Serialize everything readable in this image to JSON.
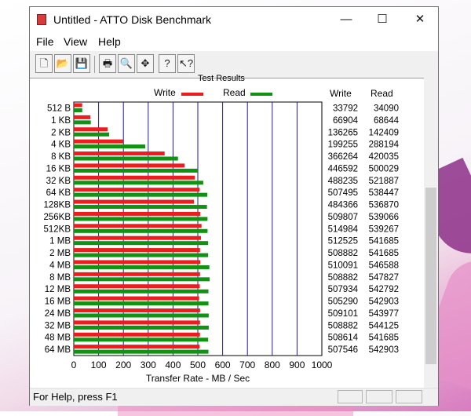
{
  "window": {
    "title": "Untitled - ATTO Disk Benchmark",
    "controls": {
      "minimize": "—",
      "maximize": "☐",
      "close": "✕"
    }
  },
  "menu": {
    "items": [
      "File",
      "View",
      "Help"
    ]
  },
  "toolbar": {
    "buttons": [
      {
        "name": "new-document-icon",
        "glyph": "🗋"
      },
      {
        "name": "open-folder-icon",
        "glyph": "📂"
      },
      {
        "name": "save-icon",
        "glyph": "💾"
      },
      {
        "name": "print-icon",
        "glyph": "🖶"
      },
      {
        "name": "print-preview-icon",
        "glyph": "🔍"
      },
      {
        "name": "move-icon",
        "glyph": "✥"
      },
      {
        "name": "help-icon",
        "glyph": "?"
      },
      {
        "name": "context-help-icon",
        "glyph": "↖?"
      }
    ]
  },
  "results": {
    "title": "Test Results",
    "legend": {
      "write": "Write",
      "read": "Read"
    },
    "columns": {
      "write": "Write",
      "read": "Read"
    }
  },
  "colors": {
    "write": "#ee1c1c",
    "read": "#129212",
    "grid": "#1a1aa6"
  },
  "chart_data": {
    "type": "bar",
    "orientation": "horizontal",
    "categories": [
      "512 B",
      "1 KB",
      "2 KB",
      "4 KB",
      "8 KB",
      "16 KB",
      "32 KB",
      "64 KB",
      "128KB",
      "256KB",
      "512KB",
      "1 MB",
      "2 MB",
      "4 MB",
      "8 MB",
      "12 MB",
      "16 MB",
      "24 MB",
      "32 MB",
      "48 MB",
      "64 MB"
    ],
    "series": [
      {
        "name": "Write",
        "values": [
          33792,
          66904,
          136265,
          199255,
          366264,
          446592,
          488235,
          507495,
          484366,
          509807,
          514984,
          512525,
          508882,
          510091,
          508882,
          507934,
          505290,
          509101,
          508882,
          508614,
          507546
        ]
      },
      {
        "name": "Read",
        "values": [
          34090,
          68644,
          142409,
          288194,
          420035,
          500029,
          521887,
          538447,
          536870,
          539066,
          539267,
          541685,
          541685,
          546588,
          547827,
          542792,
          542903,
          543977,
          544125,
          541685,
          542903
        ]
      }
    ],
    "value_unit_note": "values in KB/s as printed in the table; bars drawn in MB/s",
    "xlabel": "Transfer Rate - MB / Sec",
    "xlim": [
      0,
      1000
    ],
    "xticks": [
      0,
      100,
      200,
      300,
      400,
      500,
      600,
      700,
      800,
      900,
      1000
    ],
    "grid": true,
    "legend": "top"
  },
  "status": {
    "text": "For Help, press F1"
  }
}
